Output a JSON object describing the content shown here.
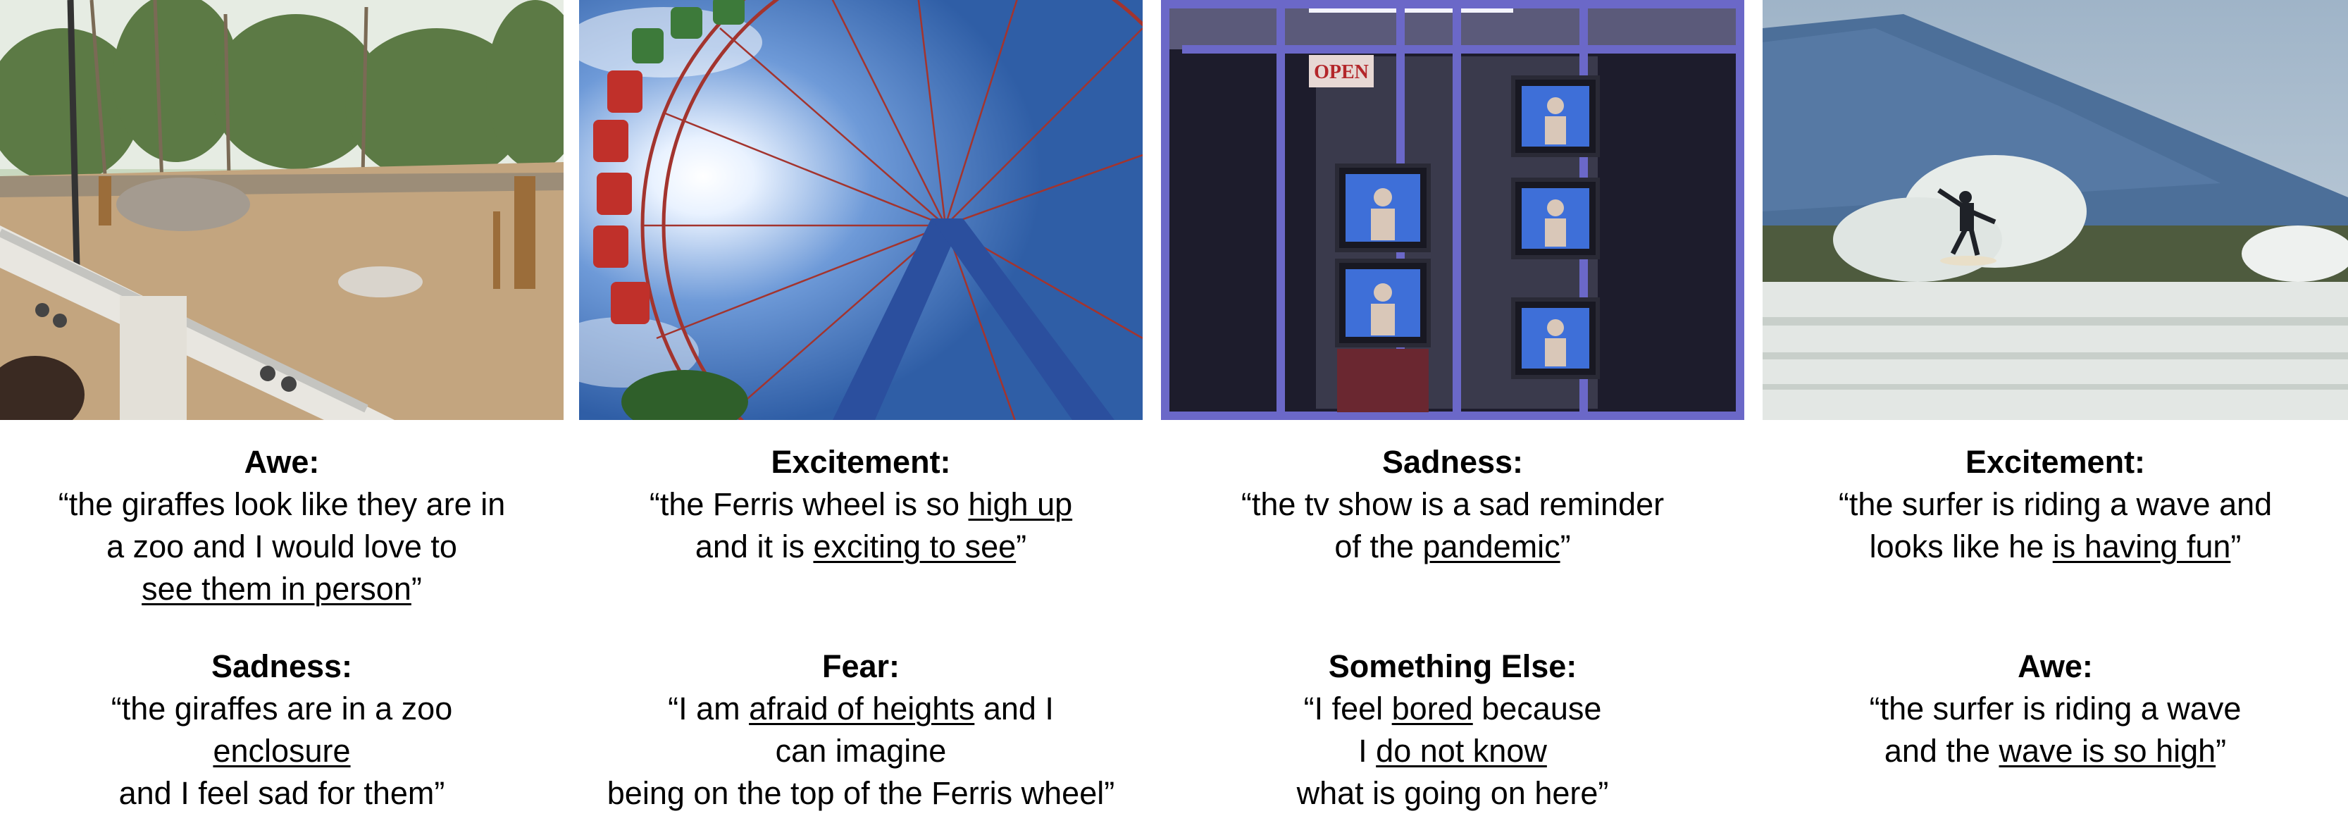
{
  "panels": [
    {
      "photo": "giraffes-in-zoo-enclosure",
      "captions": [
        {
          "emotion": "Awe:",
          "lines": [
            [
              {
                "t": "“the giraffes look like they are in"
              }
            ],
            [
              {
                "t": "a zoo and I would love to"
              }
            ],
            [
              {
                "t": "see them in person",
                "u": true
              },
              {
                "t": "”"
              }
            ]
          ]
        },
        {
          "emotion": "Sadness:",
          "lines": [
            [
              {
                "t": "“the giraffes are in a zoo"
              }
            ],
            [
              {
                "t": "enclosure",
                "u": true
              }
            ],
            [
              {
                "t": "and I feel sad for them”"
              }
            ]
          ]
        }
      ]
    },
    {
      "photo": "ferris-wheel-against-sun",
      "captions": [
        {
          "emotion": "Excitement:",
          "lines": [
            [
              {
                "t": "“the Ferris wheel is so "
              },
              {
                "t": "high up",
                "u": true
              }
            ],
            [
              {
                "t": "and it is "
              },
              {
                "t": "exciting to see",
                "u": true
              },
              {
                "t": "”"
              }
            ]
          ]
        },
        {
          "emotion": "Fear:",
          "lines": [
            [
              {
                "t": "“I am "
              },
              {
                "t": "afraid of heights",
                "u": true
              },
              {
                "t": " and I"
              }
            ],
            [
              {
                "t": "can imagine"
              }
            ],
            [
              {
                "t": "being on the top of the Ferris wheel”"
              }
            ]
          ]
        }
      ]
    },
    {
      "photo": "tvs-in-shop-window",
      "sign": "OPEN",
      "captions": [
        {
          "emotion": "Sadness:",
          "lines": [
            [
              {
                "t": "“the tv show is a sad reminder"
              }
            ],
            [
              {
                "t": "of the "
              },
              {
                "t": "pandemic",
                "u": true
              },
              {
                "t": "”"
              }
            ]
          ]
        },
        {
          "emotion": "Something Else:",
          "lines": [
            [
              {
                "t": "“I feel "
              },
              {
                "t": "bored",
                "u": true
              },
              {
                "t": " because"
              }
            ],
            [
              {
                "t": "I "
              },
              {
                "t": "do not know",
                "u": true
              }
            ],
            [
              {
                "t": "what is going on here”"
              }
            ]
          ]
        }
      ]
    },
    {
      "photo": "surfer-riding-wave",
      "captions": [
        {
          "emotion": "Excitement:",
          "lines": [
            [
              {
                "t": "“the surfer is riding a wave and"
              }
            ],
            [
              {
                "t": "looks like he "
              },
              {
                "t": "is having fun",
                "u": true
              },
              {
                "t": "”"
              }
            ]
          ]
        },
        {
          "emotion": "Awe:",
          "lines": [
            [
              {
                "t": "“the surfer is riding a wave"
              }
            ],
            [
              {
                "t": "and the "
              },
              {
                "t": "wave is so high",
                "u": true
              },
              {
                "t": "”"
              }
            ]
          ]
        }
      ]
    }
  ]
}
